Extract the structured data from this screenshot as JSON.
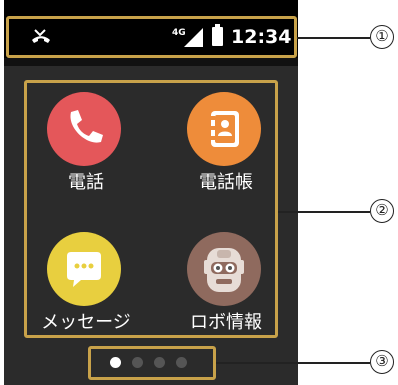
{
  "status_bar": {
    "network_type": "4G",
    "time": "12:34",
    "missed_call_icon": "missed-call-icon",
    "signal_icon": "signal-icon",
    "battery_icon": "battery-icon"
  },
  "apps": [
    {
      "label": "電話",
      "icon": "phone-icon",
      "color": "#e4575a"
    },
    {
      "label": "電話帳",
      "icon": "phonebook-icon",
      "color": "#ee8c3a"
    },
    {
      "label": "メッセージ",
      "icon": "message-icon",
      "color": "#e8cf3f"
    },
    {
      "label": "ロボ情報",
      "icon": "robot-icon",
      "color": "#8f6a5e"
    }
  ],
  "page_indicator": {
    "pages": 4,
    "current": 1
  },
  "callouts": [
    "①",
    "②",
    "③"
  ],
  "colors": {
    "screen_background": "#2b2b2b",
    "status_bar_background": "#000000",
    "callout_frame": "#c8a24a",
    "indicator_active": "#ffffff",
    "indicator_inactive": "#555555"
  }
}
